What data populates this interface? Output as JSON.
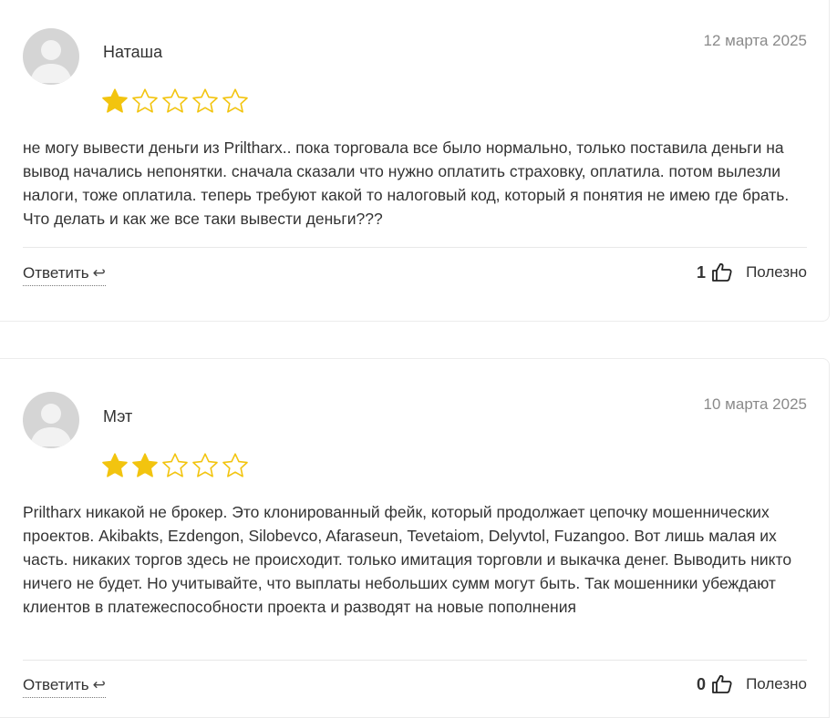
{
  "reviews": [
    {
      "author": "Наташа",
      "date": "12 марта 2025",
      "rating": 1,
      "max_rating": 5,
      "text": "не могу вывести деньги из Priltharx.. пока торговала все было нормально, только поставила деньги на вывод начались непонятки. сначала сказали что нужно оплатить страховку, оплатила. потом вылезли налоги, тоже оплатила. теперь требуют какой то налоговый код, который я понятия не имею где брать. Что делать и как же все таки вывести деньги???",
      "reply_label": "Ответить",
      "helpful_count": "1",
      "helpful_label": "Полезно"
    },
    {
      "author": "Мэт",
      "date": "10 марта 2025",
      "rating": 2,
      "max_rating": 5,
      "text": "Priltharx никакой не брокер. Это клонированный фейк, который продолжает цепочку мошеннических проектов. Akibakts, Ezdengon, Silobevco, Afaraseun, Tevetaiom, Delyvtol, Fuzangoo. Вот лишь малая их часть. никаких торгов здесь не происходит. только имитация торговли и выкачка денег. Выводить никто ничего не будет. Но учитывайте, что выплаты небольших сумм могут быть. Так мошенники убеждают клиентов в платежеспособности проекта и разводят на новые пополнения",
      "reply_label": "Ответить",
      "helpful_count": "0",
      "helpful_label": "Полезно"
    }
  ],
  "icons": {
    "star_filled": "star-filled-icon",
    "star_empty": "star-empty-icon",
    "reply": "reply-arrow-icon",
    "thumb": "thumbs-up-icon",
    "avatar": "user-avatar-icon"
  },
  "colors": {
    "star": "#f2c40f",
    "avatar_bg": "#d5d5d5",
    "avatar_fg": "#f2f2f2",
    "date": "#8a8a8a"
  }
}
